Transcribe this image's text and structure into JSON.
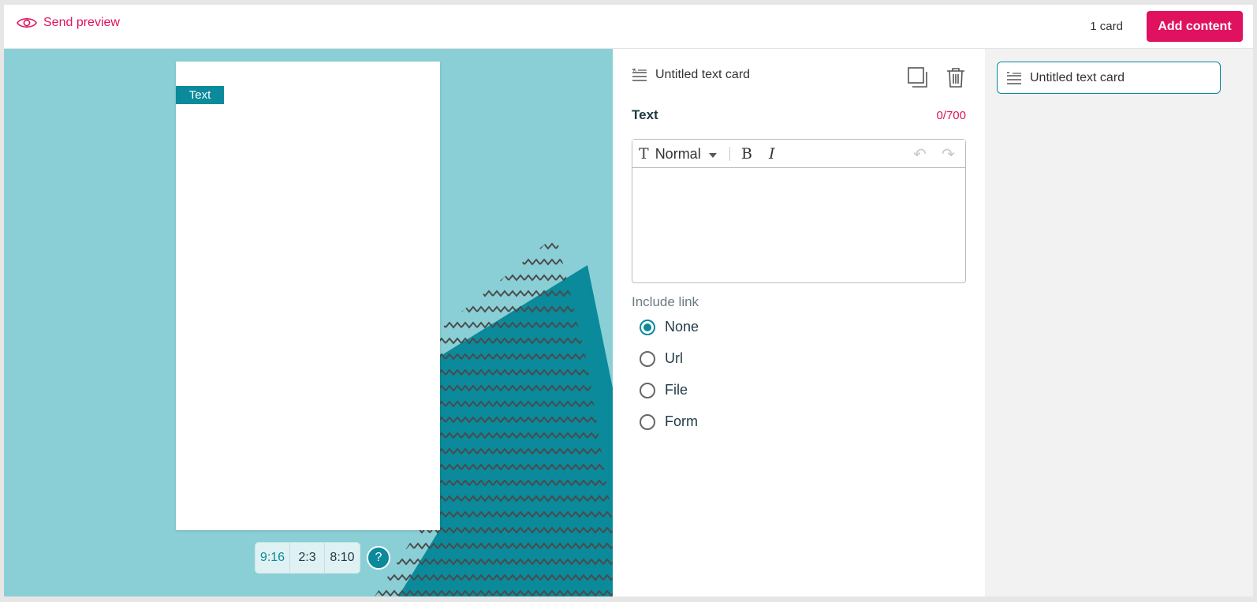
{
  "topbar": {
    "send_preview_label": "Send preview",
    "card_count": "1 card",
    "add_content_label": "Add content"
  },
  "canvas": {
    "text_label": "Text",
    "ratios": [
      "9:16",
      "2:3",
      "8:10"
    ],
    "active_ratio": "9:16",
    "help_glyph": "?"
  },
  "editor": {
    "card_title": "Untitled text card",
    "field_label": "Text",
    "char_count": "0/700",
    "format_label": "Normal",
    "bold_glyph": "B",
    "italic_glyph": "I",
    "undo_glyph": "↶",
    "redo_glyph": "↷",
    "include_link_label": "Include link",
    "link_options": [
      "None",
      "Url",
      "File",
      "Form"
    ],
    "selected_link": "None"
  },
  "sidebar": {
    "card_item_label": "Untitled text card"
  },
  "colors": {
    "accent_pink": "#e0115f",
    "teal": "#0a8a9b",
    "canvas_bg": "#8acfd6"
  }
}
